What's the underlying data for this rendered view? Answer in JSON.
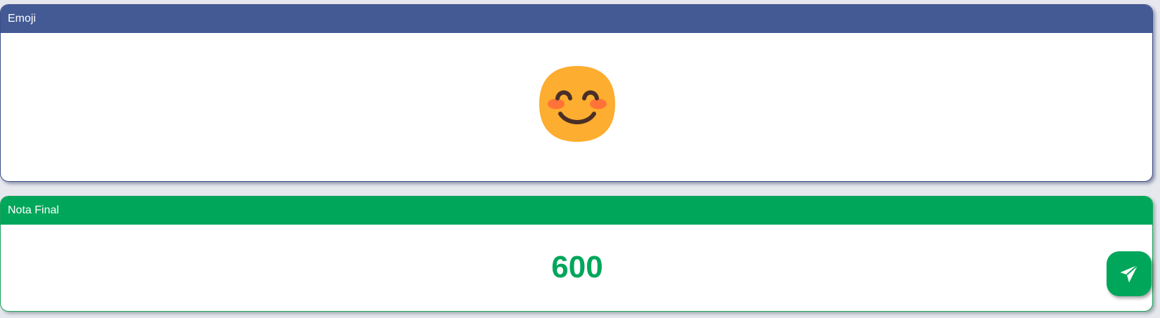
{
  "emoji_card": {
    "title": "Emoji",
    "emoji": "smiling-face-with-smiling-eyes-icon",
    "colors": {
      "header": "#445a95",
      "face": "#fdad2f",
      "features": "#4a2f27",
      "cheeks": "#ff6d3a"
    }
  },
  "nota_card": {
    "title": "Nota Final",
    "value": "600",
    "colors": {
      "header": "#00a65a",
      "value": "#00a65a"
    }
  },
  "send_button": {
    "icon": "paper-plane-icon",
    "color": "#00a65a"
  }
}
